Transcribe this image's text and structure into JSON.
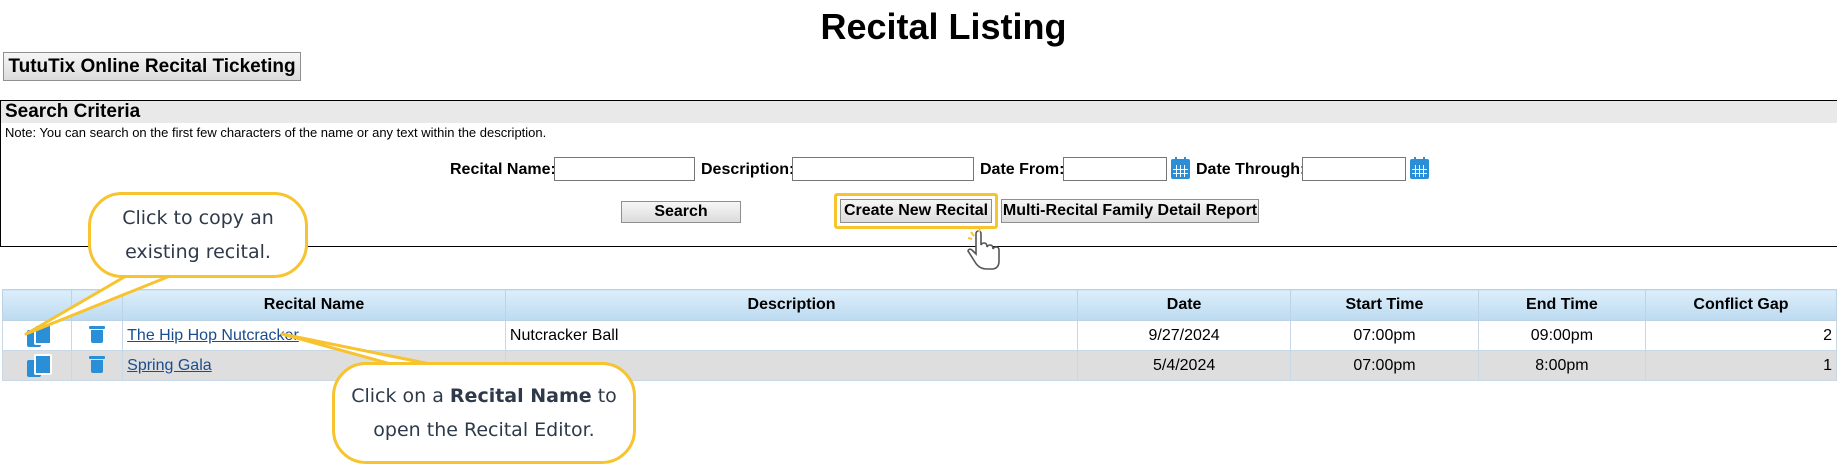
{
  "page": {
    "title": "Recital Listing",
    "tututix_button_label": "TutuTix Online Recital Ticketing"
  },
  "search": {
    "header": "Search Criteria",
    "note": "Note: You can search on the first few characters of the name or any text within the description.",
    "recital_name_label": "Recital Name:",
    "recital_name_value": "",
    "description_label": "Description:",
    "description_value": "",
    "date_from_label": "Date From:",
    "date_from_value": "",
    "date_through_label": "Date Through:",
    "date_through_value": "",
    "search_button_label": "Search",
    "create_button_label": "Create New Recital",
    "multi_report_button_label": "Multi-Recital Family Detail Report"
  },
  "table": {
    "headers": {
      "recital_name": "Recital Name",
      "description": "Description",
      "date": "Date",
      "start_time": "Start Time",
      "end_time": "End Time",
      "conflict_gap": "Conflict Gap"
    },
    "rows": [
      {
        "recital_name": "The Hip Hop Nutcracker",
        "description": "Nutcracker Ball",
        "date": "9/27/2024",
        "start_time": "07:00pm",
        "end_time": "09:00pm",
        "conflict_gap": "2"
      },
      {
        "recital_name": "Spring Gala",
        "description": "",
        "date": "5/4/2024",
        "start_time": "07:00pm",
        "end_time": "8:00pm",
        "conflict_gap": "1"
      }
    ]
  },
  "callouts": {
    "copy": {
      "line1": "Click to copy an",
      "line2": "existing recital."
    },
    "name": {
      "prefix": "Click on a ",
      "bold": "Recital Name",
      "suffix": " to",
      "line2": "open the Recital Editor."
    }
  },
  "icons": {
    "copy": "copy-icon",
    "delete": "trash-icon",
    "calendar": "calendar-icon",
    "pointer": "hand-pointer-icon"
  },
  "colors": {
    "accent_blue": "#2a8fd6",
    "callout_border": "#f7c32e",
    "link": "#1a4d8f",
    "alt_row": "#dedede"
  }
}
